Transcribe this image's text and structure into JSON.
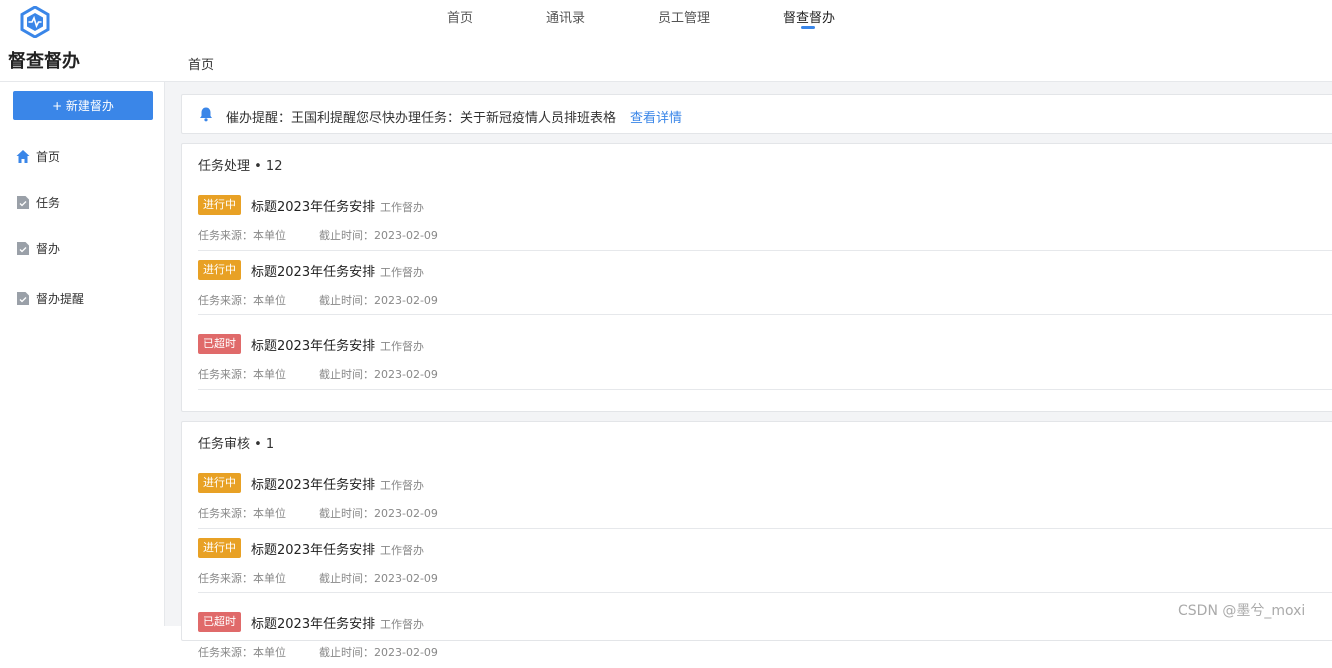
{
  "nav": {
    "items": [
      {
        "label": "首页"
      },
      {
        "label": "通讯录"
      },
      {
        "label": "员工管理"
      },
      {
        "label": "督查督办"
      }
    ],
    "active": "督查督办",
    "accent_color": "#3a86e8"
  },
  "app": {
    "title": "督查督办"
  },
  "breadcrumb": {
    "current": "首页"
  },
  "sidebar": {
    "new_button": "+ 新建督办",
    "items": [
      {
        "label": "首页",
        "icon": "home-icon"
      },
      {
        "label": "任务",
        "icon": "document-check-icon"
      },
      {
        "label": "督办",
        "icon": "document-check-icon"
      },
      {
        "label": "督办提醒",
        "icon": "document-check-icon"
      }
    ]
  },
  "notice": {
    "icon": "bell-icon",
    "text": "催办提醒：王国利提醒您尽快办理任务：关于新冠疫情人员排班表格",
    "link": "查看详情"
  },
  "sections": [
    {
      "title": "任务处理 • 12",
      "tasks": [
        {
          "status": "进行中",
          "status_color": "#e8a125",
          "title": "标题2023年任务安排",
          "category": "工作督办",
          "source": "任务来源：本单位",
          "deadline": "截止时间：2023-02-09"
        },
        {
          "status": "进行中",
          "status_color": "#e8a125",
          "title": "标题2023年任务安排",
          "category": "工作督办",
          "source": "任务来源：本单位",
          "deadline": "截止时间：2023-02-09"
        },
        {
          "status": "已超时",
          "status_color": "#e06a6a",
          "title": "标题2023年任务安排",
          "category": "工作督办",
          "source": "任务来源：本单位",
          "deadline": "截止时间：2023-02-09"
        }
      ]
    },
    {
      "title": "任务审核 • 1",
      "tasks": [
        {
          "status": "进行中",
          "status_color": "#e8a125",
          "title": "标题2023年任务安排",
          "category": "工作督办",
          "source": "任务来源：本单位",
          "deadline": "截止时间：2023-02-09"
        },
        {
          "status": "进行中",
          "status_color": "#e8a125",
          "title": "标题2023年任务安排",
          "category": "工作督办",
          "source": "任务来源：本单位",
          "deadline": "截止时间：2023-02-09"
        },
        {
          "status": "已超时",
          "status_color": "#e06a6a",
          "title": "标题2023年任务安排",
          "category": "工作督办",
          "source": "任务来源：本单位",
          "deadline": "截止时间：2023-02-09"
        }
      ]
    }
  ],
  "watermark": "CSDN @墨兮_moxi"
}
